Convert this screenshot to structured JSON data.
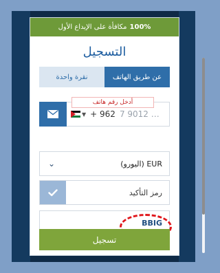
{
  "promo_banner": {
    "percent": "100%",
    "text": "مكافأة على الإيداع الأول"
  },
  "title": "التسجيل",
  "tabs": {
    "phone": "عن طريق الهاتف",
    "one_click": "نقرة واحدة"
  },
  "phone": {
    "hint": "أدخل رقم هاتف",
    "code": "+ 962",
    "placeholder": "7 9012 …"
  },
  "currency": {
    "value": "EUR (اليورو)"
  },
  "confirm": {
    "label": "رمز التأكيد"
  },
  "promo": {
    "code": "BBIG"
  },
  "register": {
    "label": "تسجيل"
  },
  "colors": {
    "accent": "#2f6ea9",
    "promo_green": "#6e9a39",
    "button_green": "#7fa53b",
    "highlight_red": "#e0161b"
  },
  "icons": {
    "mail": "mail-icon",
    "check": "check-icon",
    "chevron": "chevron-down-icon"
  }
}
